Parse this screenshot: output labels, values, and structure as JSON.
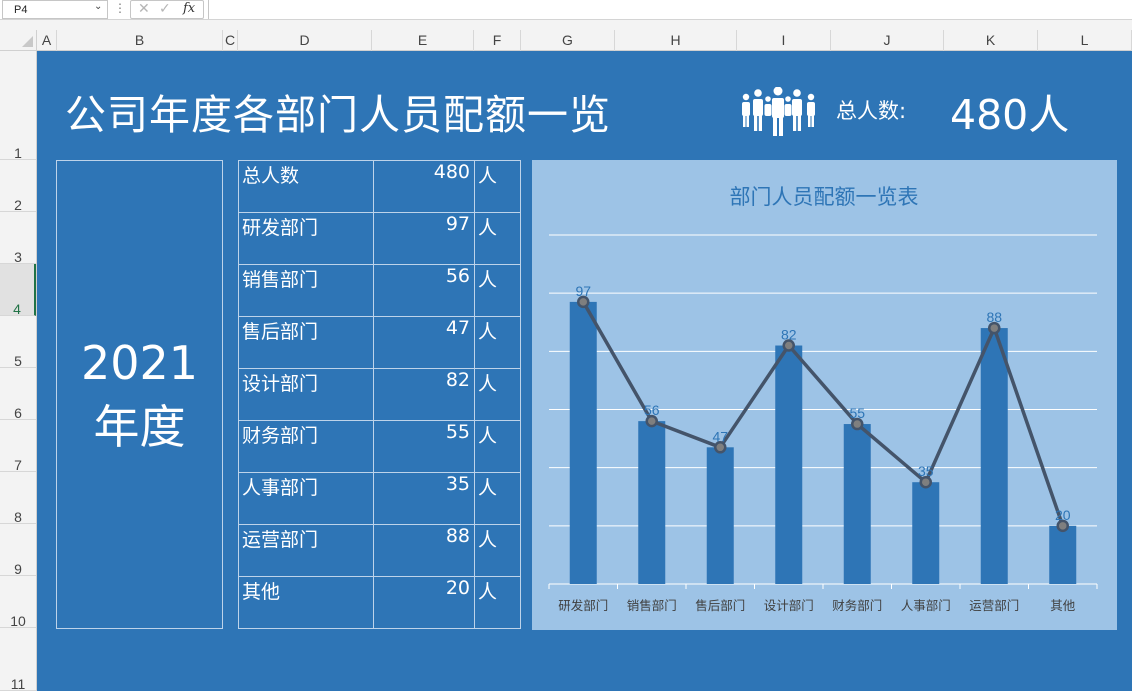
{
  "formula_bar": {
    "name_box": "P4",
    "fx": "fx",
    "formula": ""
  },
  "columns": [
    "A",
    "B",
    "C",
    "D",
    "E",
    "F",
    "G",
    "H",
    "I",
    "J",
    "K",
    "L"
  ],
  "rows": [
    "1",
    "2",
    "3",
    "4",
    "5",
    "6",
    "7",
    "8",
    "9",
    "10",
    "11"
  ],
  "header": {
    "title": "公司年度各部门人员配额一览",
    "total_label": "总人数:",
    "total_value": "480人"
  },
  "year_panel": {
    "line1": "2021",
    "line2": "年度"
  },
  "table": {
    "rows": [
      {
        "name": "总人数",
        "value": "480",
        "unit": "人"
      },
      {
        "name": "研发部门",
        "value": "97",
        "unit": "人"
      },
      {
        "name": "销售部门",
        "value": "56",
        "unit": "人"
      },
      {
        "name": "售后部门",
        "value": "47",
        "unit": "人"
      },
      {
        "name": "设计部门",
        "value": "82",
        "unit": "人"
      },
      {
        "name": "财务部门",
        "value": "55",
        "unit": "人"
      },
      {
        "name": "人事部门",
        "value": "35",
        "unit": "人"
      },
      {
        "name": "运营部门",
        "value": "88",
        "unit": "人"
      },
      {
        "name": "其他",
        "value": "20",
        "unit": "人"
      }
    ]
  },
  "chart_data": {
    "type": "bar",
    "title": "部门人员配额一览表",
    "categories": [
      "研发部门",
      "销售部门",
      "售后部门",
      "设计部门",
      "财务部门",
      "人事部门",
      "运营部门",
      "其他"
    ],
    "series": [
      {
        "type": "bar",
        "values": [
          97,
          56,
          47,
          82,
          55,
          35,
          88,
          20
        ]
      },
      {
        "type": "line",
        "values": [
          97,
          56,
          47,
          82,
          55,
          35,
          88,
          20
        ]
      }
    ],
    "ylim": [
      0,
      120
    ],
    "grid": true,
    "legend": "none",
    "colors": {
      "bar": "#2e75b6",
      "line": "#44546a",
      "labels": "#2e75b6",
      "background": "#9dc3e6"
    }
  }
}
